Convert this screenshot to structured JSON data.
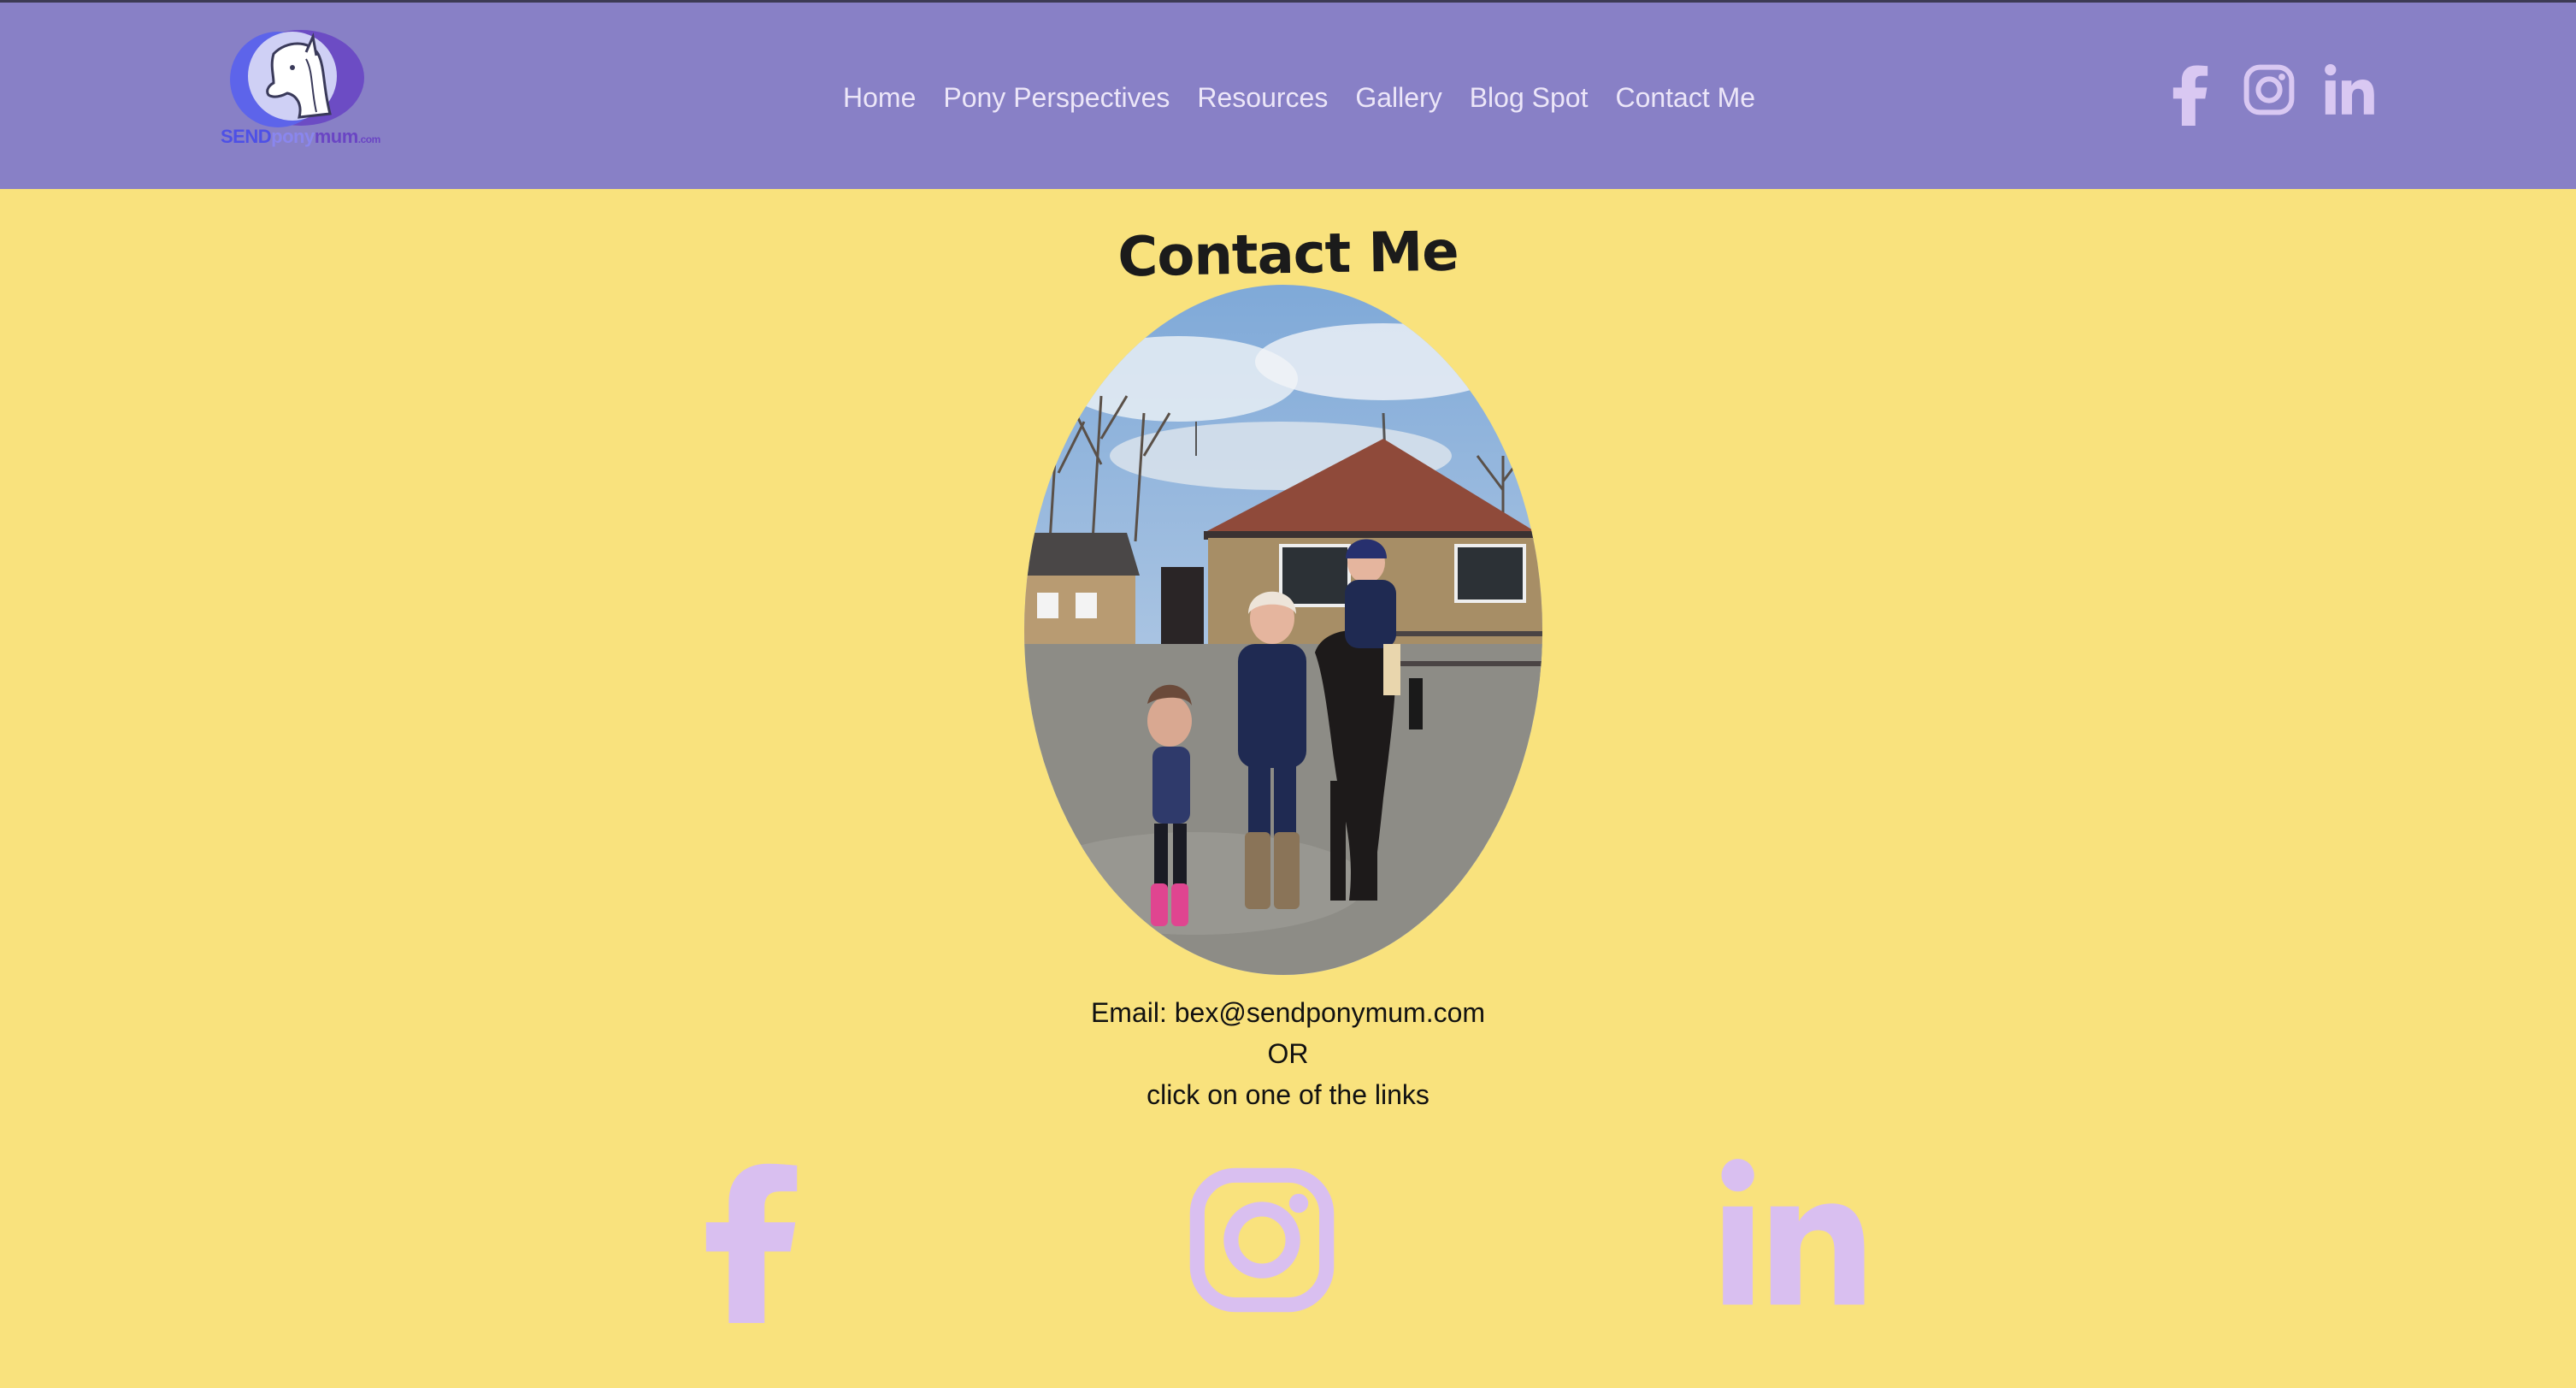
{
  "brand": {
    "logo_text_1": "SEND",
    "logo_text_2": "pony",
    "logo_text_3": "mum",
    "logo_text_4": ".com"
  },
  "nav": {
    "items": [
      {
        "label": "Home"
      },
      {
        "label": "Pony Perspectives"
      },
      {
        "label": "Resources"
      },
      {
        "label": "Gallery"
      },
      {
        "label": "Blog Spot"
      },
      {
        "label": "Contact Me"
      }
    ]
  },
  "header_social": {
    "icons": [
      "facebook-icon",
      "instagram-icon",
      "linkedin-icon"
    ]
  },
  "main": {
    "title": "Contact Me",
    "email_line": "Email: bex@sendponymum.com",
    "or_line": "OR",
    "links_line": "click on one of the links"
  },
  "footer_social": {
    "icons": [
      "facebook-icon",
      "instagram-icon",
      "linkedin-icon"
    ]
  },
  "colors": {
    "header_bg": "#8880c6",
    "page_bg": "#f9e27d",
    "nav_text": "#ece6f8",
    "header_icon": "#d9c8f2",
    "footer_icon": "#d9bff0",
    "title_text": "#1b1b1b"
  }
}
